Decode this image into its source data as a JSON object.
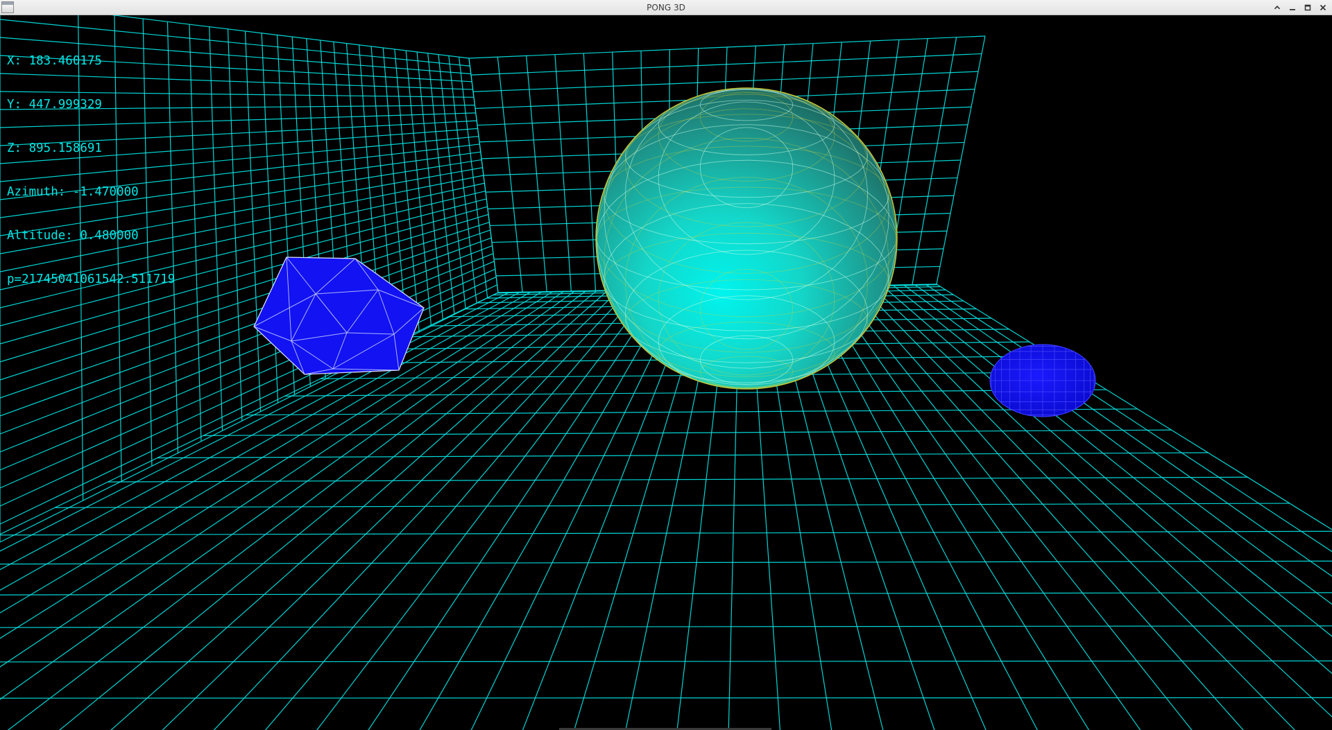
{
  "window": {
    "title": "PONG 3D",
    "controls": [
      {
        "name": "window-shade-button",
        "icon": "chevron-up-icon"
      },
      {
        "name": "minimize-button",
        "icon": "minimize-icon"
      },
      {
        "name": "maximize-button",
        "icon": "maximize-icon"
      },
      {
        "name": "close-button",
        "icon": "close-icon"
      }
    ]
  },
  "hud": {
    "x": "X: 183.460175",
    "y": "Y: 447.999329",
    "z": "Z: 895.158691",
    "azimuth": "Azimuth: -1.470000",
    "altitude": "Altitude: 0.480000",
    "p": "p=21745041061542.511719"
  },
  "colors": {
    "grid": "#00e0e0",
    "sphere_fill": "#00f0e0",
    "sphere_wire_outer": "#d8d830",
    "sphere_wire_inner": "#c8ffe8",
    "paddle_fill": "#1010f0",
    "paddle_wire": "#c8d0ff"
  },
  "scene": {
    "objects": [
      {
        "name": "cyan-ball",
        "shape": "geodesic-sphere"
      },
      {
        "name": "left-paddle",
        "shape": "icosahedron"
      },
      {
        "name": "right-paddle",
        "shape": "ellipsoid"
      }
    ]
  }
}
